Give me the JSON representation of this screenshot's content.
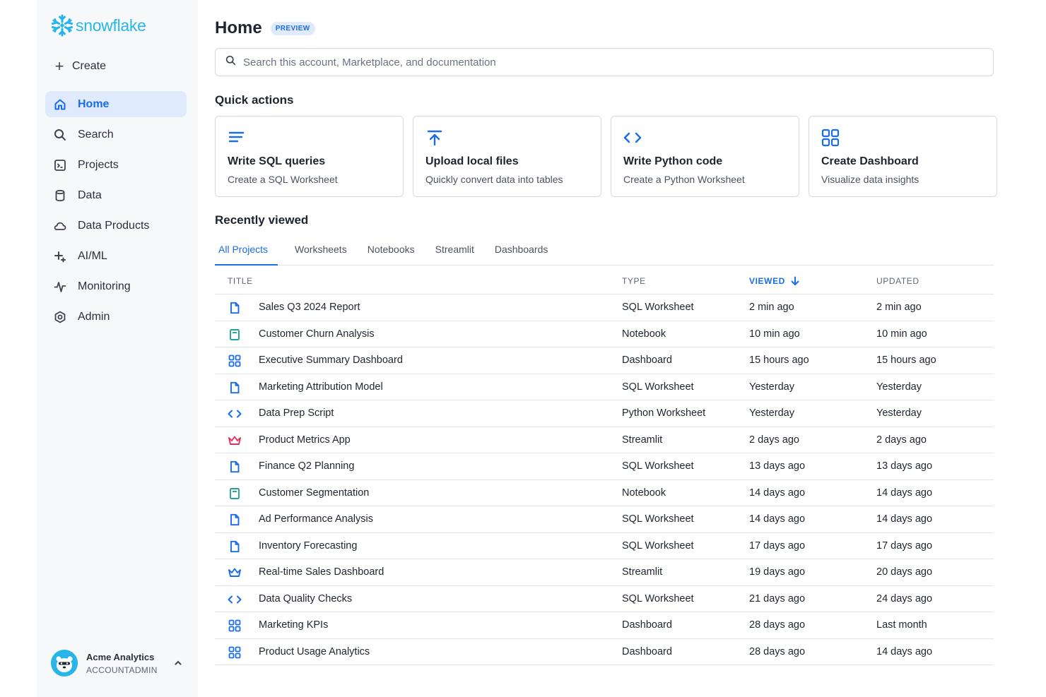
{
  "brand": {
    "name": "snowflake",
    "color": "#29b5e8"
  },
  "sidebar": {
    "create_label": "Create",
    "items": [
      {
        "label": "Home",
        "icon": "home-icon",
        "active": true
      },
      {
        "label": "Search",
        "icon": "search-icon",
        "active": false
      },
      {
        "label": "Projects",
        "icon": "projects-icon",
        "active": false
      },
      {
        "label": "Data",
        "icon": "database-icon",
        "active": false
      },
      {
        "label": "Data Products",
        "icon": "cloud-icon",
        "active": false
      },
      {
        "label": "AI/ML",
        "icon": "sparkle-icon",
        "active": false
      },
      {
        "label": "Monitoring",
        "icon": "activity-icon",
        "active": false
      },
      {
        "label": "Admin",
        "icon": "gear-icon",
        "active": false
      }
    ],
    "account": {
      "name": "Acme Analytics",
      "role": "ACCOUNTADMIN"
    }
  },
  "header": {
    "title": "Home",
    "badge": "PREVIEW"
  },
  "search": {
    "placeholder": "Search this account, Marketplace, and documentation",
    "value": ""
  },
  "quick_actions": {
    "title": "Quick actions",
    "cards": [
      {
        "title": "Write SQL queries",
        "subtitle": "Create a SQL Worksheet",
        "icon": "lines-icon"
      },
      {
        "title": "Upload local files",
        "subtitle": "Quickly convert data into tables",
        "icon": "upload-icon"
      },
      {
        "title": "Write Python code",
        "subtitle": "Create a Python Worksheet",
        "icon": "code-icon"
      },
      {
        "title": "Create Dashboard",
        "subtitle": "Visualize data insights",
        "icon": "grid-icon"
      }
    ]
  },
  "recent": {
    "title": "Recently viewed",
    "tabs": [
      {
        "label": "All Projects",
        "active": true
      },
      {
        "label": "Worksheets",
        "active": false
      },
      {
        "label": "Notebooks",
        "active": false
      },
      {
        "label": "Streamlit",
        "active": false
      },
      {
        "label": "Dashboards",
        "active": false
      }
    ],
    "columns": {
      "title": "TITLE",
      "type": "TYPE",
      "viewed": "VIEWED",
      "updated": "UPDATED"
    },
    "sort": {
      "column": "viewed",
      "direction": "desc"
    },
    "rows": [
      {
        "icon": "file-icon",
        "title": "Sales Q3 2024 Report",
        "type": "SQL Worksheet",
        "viewed": "2 min ago",
        "updated": "2 min ago"
      },
      {
        "icon": "notebook-icon",
        "title": "Customer Churn Analysis",
        "type": "Notebook",
        "viewed": "10 min ago",
        "updated": "10 min ago"
      },
      {
        "icon": "dashboard-icon",
        "title": "Executive Summary Dashboard",
        "type": "Dashboard",
        "viewed": "15 hours ago",
        "updated": "15 hours ago"
      },
      {
        "icon": "file-icon",
        "title": "Marketing Attribution Model",
        "type": "SQL Worksheet",
        "viewed": "Yesterday",
        "updated": "Yesterday"
      },
      {
        "icon": "code-icon",
        "title": "Data Prep Script",
        "type": "Python Worksheet",
        "viewed": "Yesterday",
        "updated": "Yesterday"
      },
      {
        "icon": "crown-red-icon",
        "title": "Product Metrics App",
        "type": "Streamlit",
        "viewed": "2 days ago",
        "updated": "2 days ago"
      },
      {
        "icon": "file-icon",
        "title": "Finance Q2 Planning",
        "type": "SQL Worksheet",
        "viewed": "13 days ago",
        "updated": "13 days ago"
      },
      {
        "icon": "notebook-icon",
        "title": "Customer Segmentation",
        "type": "Notebook",
        "viewed": "14 days ago",
        "updated": "14 days ago"
      },
      {
        "icon": "file-icon",
        "title": "Ad Performance Analysis",
        "type": "SQL Worksheet",
        "viewed": "14 days ago",
        "updated": "14 days ago"
      },
      {
        "icon": "file-icon",
        "title": "Inventory Forecasting",
        "type": "SQL Worksheet",
        "viewed": "17 days ago",
        "updated": "17 days ago"
      },
      {
        "icon": "crown-blue-icon",
        "title": "Real-time Sales Dashboard",
        "type": "Streamlit",
        "viewed": "19 days ago",
        "updated": "20 days ago"
      },
      {
        "icon": "code-icon",
        "title": "Data Quality Checks",
        "type": "SQL Worksheet",
        "viewed": "21 days ago",
        "updated": "24 days ago"
      },
      {
        "icon": "dashboard-icon",
        "title": "Marketing KPIs",
        "type": "Dashboard",
        "viewed": "28 days ago",
        "updated": "Last month"
      },
      {
        "icon": "dashboard-icon",
        "title": "Product Usage Analytics",
        "type": "Dashboard",
        "viewed": "28 days ago",
        "updated": "14 days ago"
      }
    ]
  },
  "colors": {
    "accent": "#1a6ce8",
    "teal": "#1fa39a",
    "red": "#e0335b"
  }
}
